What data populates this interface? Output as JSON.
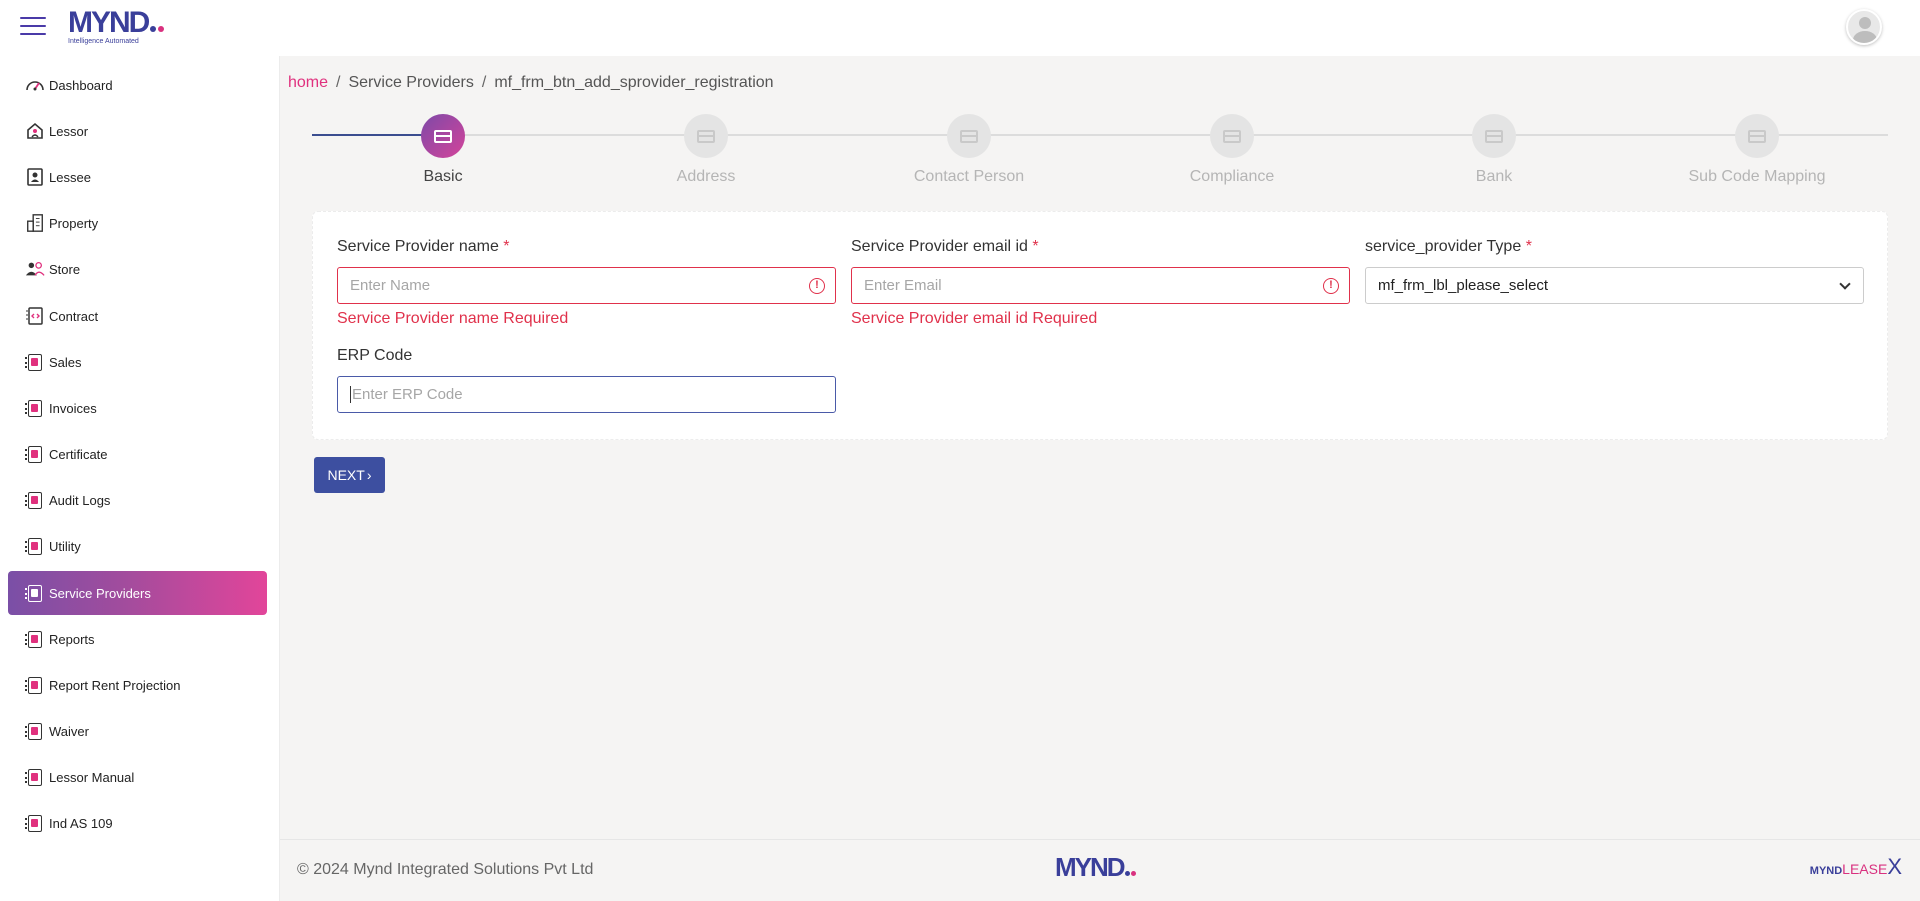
{
  "app": {
    "logo_text": "MYND",
    "logo_tagline": "Intelligence Automated"
  },
  "sidebar": {
    "items": [
      {
        "label": "Dashboard",
        "icon": "speedometer-icon"
      },
      {
        "label": "Lessor",
        "icon": "home-user-icon"
      },
      {
        "label": "Lessee",
        "icon": "id-badge-icon"
      },
      {
        "label": "Property",
        "icon": "building-icon"
      },
      {
        "label": "Store",
        "icon": "users-icon"
      },
      {
        "label": "Contract",
        "icon": "code-doc-icon"
      },
      {
        "label": "Sales",
        "icon": "doc-icon"
      },
      {
        "label": "Invoices",
        "icon": "doc-icon"
      },
      {
        "label": "Certificate",
        "icon": "doc-icon"
      },
      {
        "label": "Audit Logs",
        "icon": "doc-icon"
      },
      {
        "label": "Utility",
        "icon": "doc-icon"
      },
      {
        "label": "Service Providers",
        "icon": "doc-icon",
        "active": true
      },
      {
        "label": "Reports",
        "icon": "doc-icon"
      },
      {
        "label": "Report Rent Projection",
        "icon": "doc-icon"
      },
      {
        "label": "Waiver",
        "icon": "doc-icon"
      },
      {
        "label": "Lessor Manual",
        "icon": "doc-icon"
      },
      {
        "label": "Ind AS 109",
        "icon": "doc-icon"
      }
    ]
  },
  "breadcrumb": {
    "home": "home",
    "section": "Service Providers",
    "current": "mf_frm_btn_add_sprovider_registration",
    "separator": "/"
  },
  "stepper": {
    "steps": [
      {
        "label": "Basic",
        "active": true
      },
      {
        "label": "Address"
      },
      {
        "label": "Contact Person"
      },
      {
        "label": "Compliance"
      },
      {
        "label": "Bank"
      },
      {
        "label": "Sub Code Mapping"
      }
    ]
  },
  "form": {
    "name": {
      "label": "Service Provider name",
      "required": "*",
      "placeholder": "Enter Name",
      "error": "Service Provider name Required"
    },
    "email": {
      "label": "Service Provider email id",
      "required": "*",
      "placeholder": "Enter Email",
      "error": "Service Provider email id Required"
    },
    "type": {
      "label": "service_provider Type",
      "required": "*",
      "value": "mf_frm_lbl_please_select"
    },
    "erp": {
      "label": "ERP Code",
      "placeholder": "Enter ERP Code"
    },
    "next_label": "NEXT"
  },
  "footer": {
    "copyright": "© 2024 Mynd Integrated Solutions Pvt Ltd",
    "logo_text": "MYND",
    "lease_brand_a": "MYND",
    "lease_brand_b": "LEASE",
    "lease_brand_c": "X"
  },
  "colors": {
    "accent_pink": "#e0317e",
    "brand_blue": "#3a3f9a",
    "button_blue": "#3d4fa0",
    "error_red": "#e0314b"
  }
}
